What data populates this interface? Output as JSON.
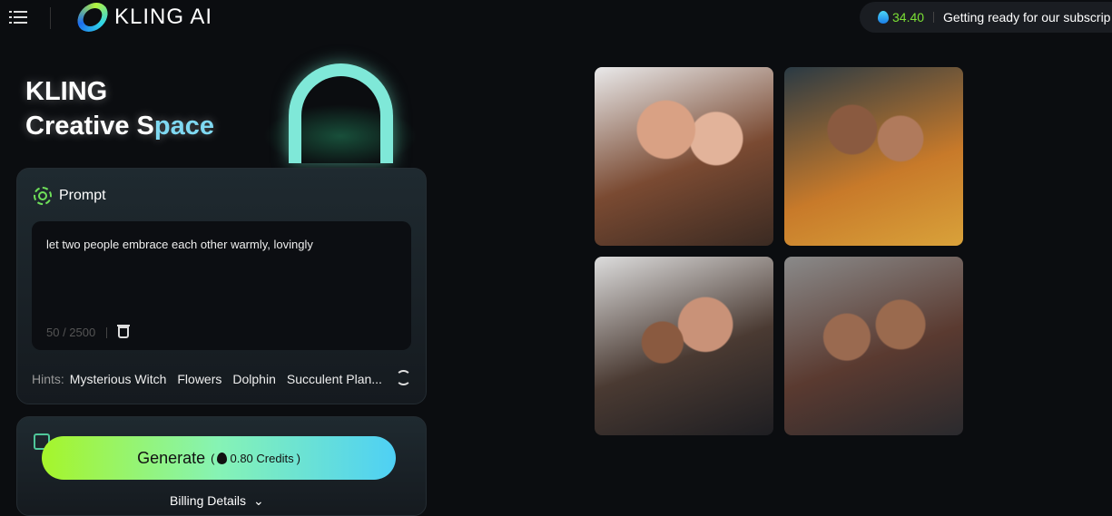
{
  "header": {
    "logo_text": "KLING AI",
    "credits": "34.40",
    "announcement": "Getting ready for our subscrip"
  },
  "hero": {
    "line1": "KLING",
    "line2_a": "Creative S",
    "line2_b": "pace"
  },
  "prompt": {
    "title": "Prompt",
    "value": "let two people embrace each other warmly, lovingly",
    "counter": "50 / 2500",
    "hints_label": "Hints:",
    "hints": [
      "Mysterious Witch",
      "Flowers",
      "Dolphin",
      "Succulent Plan..."
    ]
  },
  "generate": {
    "label": "Generate",
    "credits_open": "(",
    "credits": "0.80 Credits",
    "credits_close": ")",
    "billing": "Billing Details"
  },
  "results": [
    {
      "alt": "couple embracing 1"
    },
    {
      "alt": "couple embracing 2"
    },
    {
      "alt": "couple embracing 3"
    },
    {
      "alt": "couple embracing 4"
    }
  ],
  "colors": {
    "accent_green": "#7be035",
    "gradient_start": "#a6f52a",
    "gradient_end": "#4ed0f5"
  }
}
